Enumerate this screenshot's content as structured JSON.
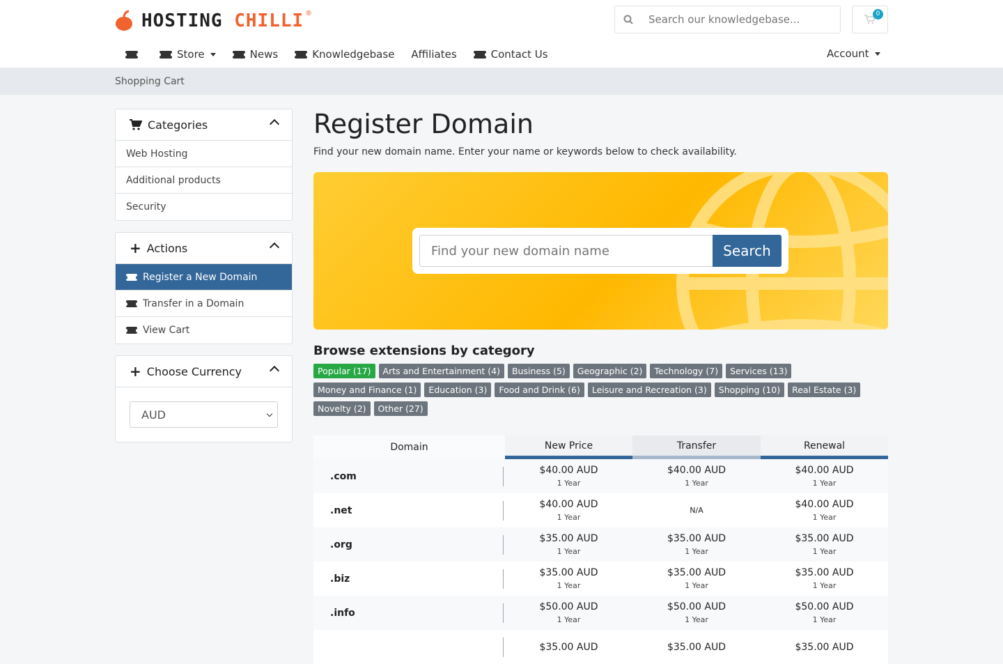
{
  "brand": {
    "name_part1": "HOSTING",
    "name_part2": "CHILLI",
    "registered": "®"
  },
  "header": {
    "search_placeholder": "Search our knowledgebase...",
    "cart_count": "0"
  },
  "nav": {
    "store": "Store",
    "news": "News",
    "knowledgebase": "Knowledgebase",
    "affiliates": "Affiliates",
    "contact": "Contact Us",
    "account": "Account"
  },
  "breadcrumb": "Shopping Cart",
  "sidebar": {
    "categories": {
      "title": "Categories",
      "items": [
        "Web Hosting",
        "Additional products",
        "Security"
      ]
    },
    "actions": {
      "title": "Actions",
      "items": [
        "Register a New Domain",
        "Transfer in a Domain",
        "View Cart"
      ]
    },
    "currency": {
      "title": "Choose Currency",
      "selected": "AUD"
    }
  },
  "main": {
    "title": "Register Domain",
    "subtitle": "Find your new domain name. Enter your name or keywords below to check availability.",
    "search_placeholder": "Find your new domain name",
    "search_button": "Search",
    "browse_title": "Browse extensions by category",
    "tags": [
      "Popular (17)",
      "Arts and Entertainment (4)",
      "Business (5)",
      "Geographic (2)",
      "Technology (7)",
      "Services (13)",
      "Money and Finance (1)",
      "Education (3)",
      "Food and Drink (6)",
      "Leisure and Recreation (3)",
      "Shopping (10)",
      "Real Estate (3)",
      "Novelty (2)",
      "Other (27)"
    ],
    "table_headers": {
      "domain": "Domain",
      "new": "New Price",
      "transfer": "Transfer",
      "renewal": "Renewal"
    },
    "rows": [
      {
        "tld": ".com",
        "new": "$40.00 AUD",
        "new_yr": "1 Year",
        "tr": "$40.00 AUD",
        "tr_yr": "1 Year",
        "rn": "$40.00 AUD",
        "rn_yr": "1 Year"
      },
      {
        "tld": ".net",
        "new": "$40.00 AUD",
        "new_yr": "1 Year",
        "tr": "N/A",
        "tr_yr": "",
        "rn": "$40.00 AUD",
        "rn_yr": "1 Year"
      },
      {
        "tld": ".org",
        "new": "$35.00 AUD",
        "new_yr": "1 Year",
        "tr": "$35.00 AUD",
        "tr_yr": "1 Year",
        "rn": "$35.00 AUD",
        "rn_yr": "1 Year"
      },
      {
        "tld": ".biz",
        "new": "$35.00 AUD",
        "new_yr": "1 Year",
        "tr": "$35.00 AUD",
        "tr_yr": "1 Year",
        "rn": "$35.00 AUD",
        "rn_yr": "1 Year"
      },
      {
        "tld": ".info",
        "new": "$50.00 AUD",
        "new_yr": "1 Year",
        "tr": "$50.00 AUD",
        "tr_yr": "1 Year",
        "rn": "$50.00 AUD",
        "rn_yr": "1 Year"
      },
      {
        "tld": "",
        "new": "$35.00 AUD",
        "new_yr": "",
        "tr": "$35.00 AUD",
        "tr_yr": "",
        "rn": "$35.00 AUD",
        "rn_yr": ""
      }
    ]
  },
  "colors": {
    "brand_orange": "#f0622e",
    "primary": "#336699",
    "tag_active": "#28a745",
    "tag": "#6c757d"
  }
}
